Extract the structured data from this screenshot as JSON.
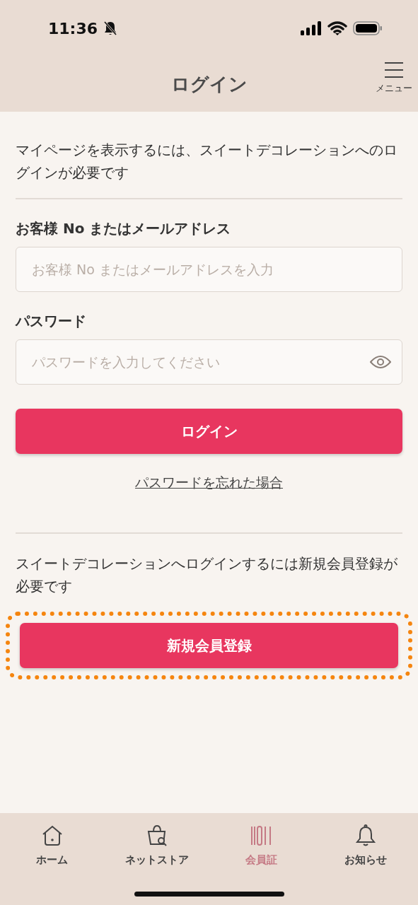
{
  "status_bar": {
    "time": "11:36",
    "silent": true
  },
  "header": {
    "title": "ログイン",
    "menu_label": "メニュー"
  },
  "intro": "マイページを表示するには、スイートデコレーションへのログインが必要です",
  "fields": [
    {
      "kind": "text",
      "label": "お客様 No またはメールアドレス",
      "placeholder": "お客様 No またはメールアドレスを入力"
    },
    {
      "kind": "password",
      "label": "パスワード",
      "placeholder": "パスワードを入力してください"
    }
  ],
  "login_button": "ログイン",
  "forgot_link": "パスワードを忘れた場合",
  "register_note": "スイートデコレーションへログインするには新規会員登録が必要です",
  "register_button": {
    "label": "新規会員登録",
    "highlighted": true
  },
  "tab_bar": [
    {
      "kind": "home",
      "label": "ホーム",
      "selected": false
    },
    {
      "kind": "store",
      "label": "ネットストア",
      "selected": false
    },
    {
      "kind": "card",
      "label": "会員証",
      "selected": true
    },
    {
      "kind": "bell",
      "label": "お知らせ",
      "selected": false
    }
  ]
}
